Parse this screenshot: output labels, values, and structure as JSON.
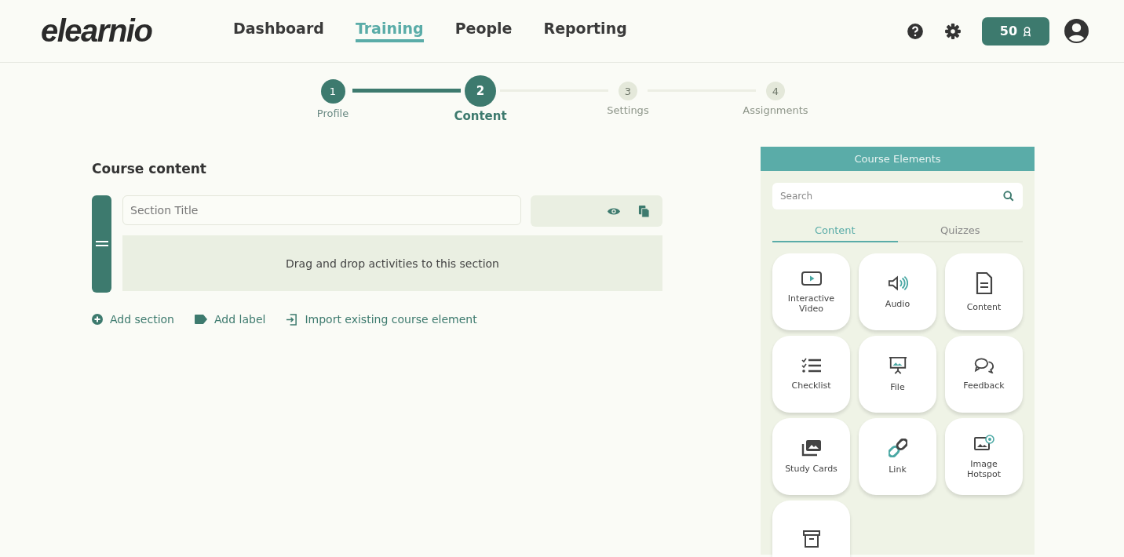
{
  "header": {
    "logo": "elearnio",
    "nav": [
      {
        "label": "Dashboard",
        "selected": false
      },
      {
        "label": "Training",
        "selected": true
      },
      {
        "label": "People",
        "selected": false
      },
      {
        "label": "Reporting",
        "selected": false
      }
    ],
    "points": "50"
  },
  "steps": [
    {
      "number": "1",
      "label": "Profile",
      "completed": true,
      "selected": false
    },
    {
      "number": "2",
      "label": "Content",
      "completed": false,
      "selected": true
    },
    {
      "number": "3",
      "label": "Settings",
      "completed": false,
      "selected": false
    },
    {
      "number": "4",
      "label": "Assignments",
      "completed": false,
      "selected": false
    }
  ],
  "course": {
    "title": "Course content",
    "section": {
      "placeholder": "Section Title",
      "dropzone": "Drag and drop activities to this section"
    },
    "actions": [
      {
        "kind": "add",
        "label": "Add section"
      },
      {
        "kind": "label",
        "label": "Add label"
      },
      {
        "kind": "import",
        "label": "Import existing course element"
      }
    ]
  },
  "panel": {
    "title": "Course Elements",
    "search": {
      "placeholder": "Search"
    },
    "tabs": [
      {
        "label": "Content",
        "selected": true
      },
      {
        "label": "Quizzes",
        "selected": false
      }
    ],
    "elements": [
      {
        "kind": "video",
        "label": "Interactive Video"
      },
      {
        "kind": "audio",
        "label": "Audio"
      },
      {
        "kind": "document",
        "label": "Content"
      },
      {
        "kind": "checklist",
        "label": "Checklist"
      },
      {
        "kind": "presentation",
        "label": "File"
      },
      {
        "kind": "chat",
        "label": "Feedback"
      },
      {
        "kind": "images",
        "label": "Study Cards"
      },
      {
        "kind": "link",
        "label": "Link"
      },
      {
        "kind": "hotspot",
        "label": "Image Hotspot"
      },
      {
        "kind": "archive"
      }
    ]
  }
}
